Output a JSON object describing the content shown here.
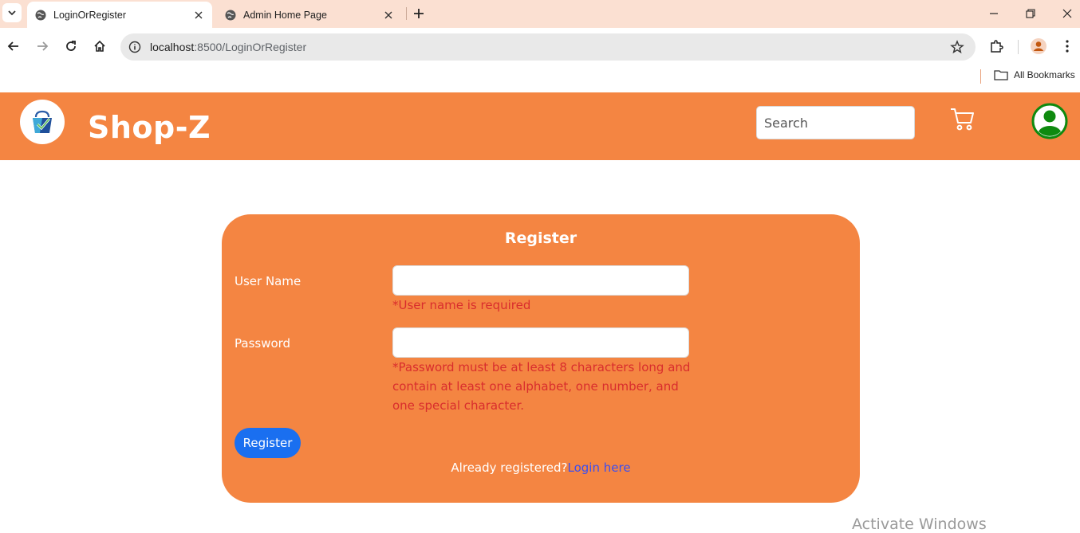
{
  "browser": {
    "tabs": [
      {
        "title": "LoginOrRegister",
        "active": true
      },
      {
        "title": "Admin Home Page",
        "active": false
      }
    ],
    "address": {
      "host": "localhost",
      "path": ":8500/LoginOrRegister"
    },
    "bookmarks_label": "All Bookmarks"
  },
  "header": {
    "brand": "Shop-Z",
    "search_placeholder": "Search",
    "colors": {
      "primary": "#f48542",
      "account": "#0f8a0f"
    }
  },
  "register": {
    "title": "Register",
    "username_label": "User Name",
    "username_error": "*User name is required",
    "password_label": "Password",
    "password_error": "*Password must be at least 8 characters long and contain at least one alphabet, one number, and one special character.",
    "submit_label": "Register",
    "already_text": "Already registered?",
    "login_link": "Login here"
  },
  "os": {
    "watermark": "Activate Windows"
  },
  "colors": {
    "accent": "#f48542",
    "button": "#1a6ff0",
    "error": "#d92d2d",
    "link": "#3c4ff0"
  }
}
